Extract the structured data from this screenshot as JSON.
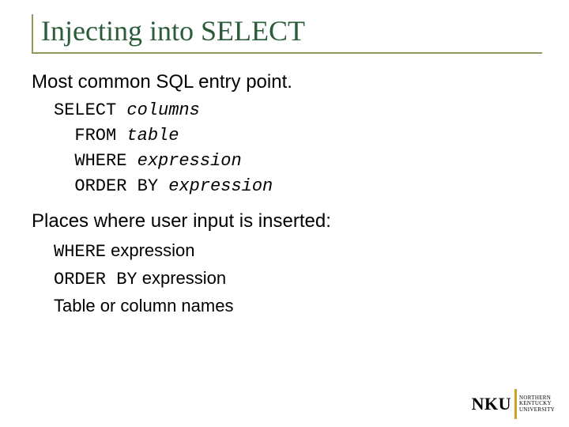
{
  "title": "Injecting into SELECT",
  "section1": "Most common SQL entry point.",
  "code": {
    "l1_kw": "SELECT ",
    "l1_it": "columns",
    "l2_kw": "  FROM ",
    "l2_it": "table",
    "l3_kw": "  WHERE ",
    "l3_it": "expression",
    "l4_kw": "  ORDER BY ",
    "l4_it": "expression"
  },
  "section2": "Places where user input is inserted:",
  "inserts": {
    "i1_mono": "WHERE",
    "i1_sans": " expression",
    "i2_mono": "ORDER BY",
    "i2_sans": " expression",
    "i3_sans": "Table or column names"
  },
  "logo": {
    "mark": "NKU",
    "line1": "NORTHERN",
    "line2": "KENTUCKY",
    "line3": "UNIVERSITY"
  }
}
